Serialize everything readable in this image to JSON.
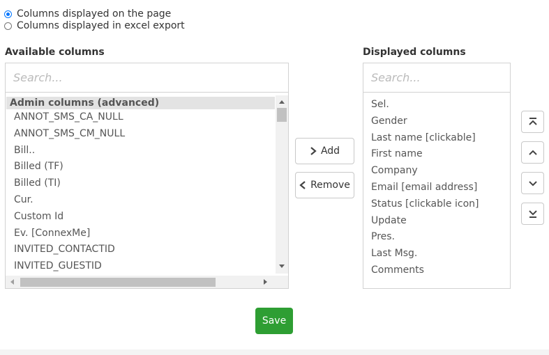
{
  "options": {
    "page": "Columns displayed on the page",
    "excel": "Columns displayed in excel export"
  },
  "available": {
    "heading": "Available columns",
    "placeholder": "Search...",
    "group": "Admin columns (advanced)",
    "items": [
      "ANNOT_SMS_CA_NULL",
      "ANNOT_SMS_CM_NULL",
      "Bill..",
      "Billed (TF)",
      "Billed (TI)",
      "Cur.",
      "Custom Id",
      "Ev. [ConnexMe]",
      "INVITED_CONTACTID",
      "INVITED_GUESTID"
    ]
  },
  "displayed": {
    "heading": "Displayed columns",
    "placeholder": "Search...",
    "items": [
      "Sel.",
      "Gender",
      "Last name [clickable]",
      "First name",
      "Company",
      "Email [email address]",
      "Status [clickable icon]",
      "Update",
      "Pres.",
      "Last Msg.",
      "Comments"
    ]
  },
  "buttons": {
    "add": "Add",
    "remove": "Remove",
    "save": "Save"
  },
  "colors": {
    "save": "#2e9e33",
    "radio": "#0075ff"
  }
}
